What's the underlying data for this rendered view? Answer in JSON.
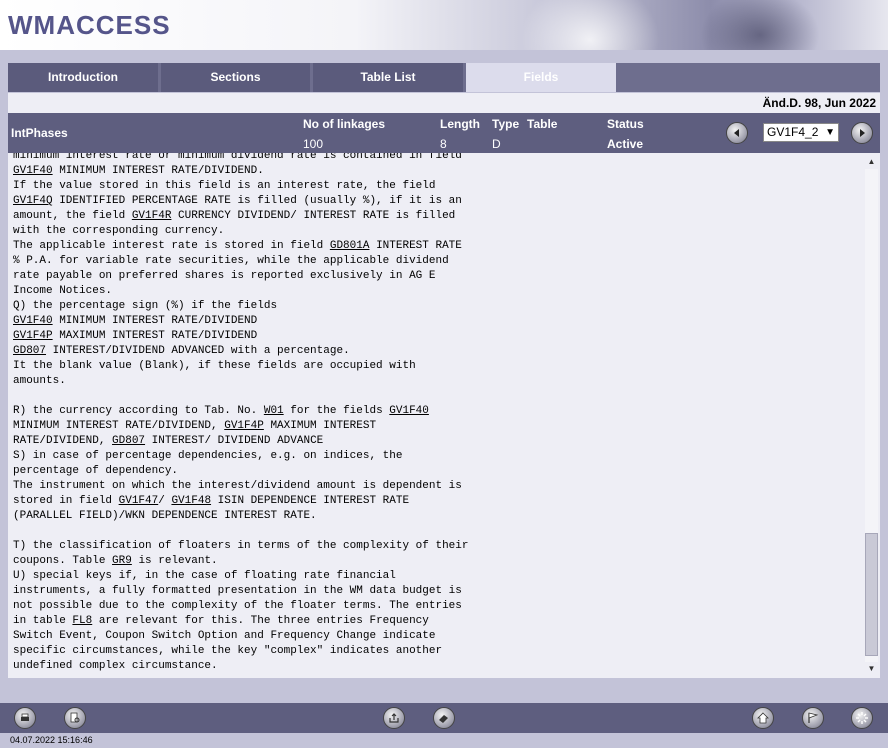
{
  "app": {
    "title": "WMACCESS"
  },
  "tabs": [
    {
      "label": "Introduction"
    },
    {
      "label": "Sections"
    },
    {
      "label": "Table List"
    },
    {
      "label": "Fields"
    }
  ],
  "date_info": "Änd.D. 98,  Jun 2022",
  "infobar": {
    "section": "IntPhases",
    "linkages_label": "No of linkages",
    "linkages_value": "100",
    "length_label": "Length",
    "length_value": "8",
    "type_label": "Type",
    "type_value": "D",
    "table_label": "Table",
    "status_label": "Status",
    "status_value": "Active",
    "field_select": "GV1F4_2"
  },
  "content_lines": [
    "minimum interest rate or minimum dividend rate is contained in field",
    "GV1F40 MINIMUM INTEREST RATE/DIVIDEND.",
    "If the value stored in this field is an interest rate, the field",
    "GV1F4Q IDENTIFIED PERCENTAGE RATE is filled (usually %), if it is an",
    "amount, the field GV1F4R CURRENCY DIVIDEND/ INTEREST RATE is filled",
    "with the corresponding currency.",
    "The applicable interest rate is stored in field GD801A INTEREST RATE",
    "% P.A. for variable rate securities, while the applicable dividend",
    "rate payable on preferred shares is reported exclusively in AG E",
    "Income Notices.",
    "Q) the percentage sign (%) if the fields",
    "GV1F40 MINIMUM INTEREST RATE/DIVIDEND",
    "GV1F4P MAXIMUM INTEREST RATE/DIVIDEND",
    "GD807 INTEREST/DIVIDEND ADVANCED with a percentage.",
    "It the blank value (Blank), if these fields are occupied with",
    "amounts.",
    "",
    "R) the currency according to Tab. No. W01 for the fields GV1F40",
    "MINIMUM INTEREST RATE/DIVIDEND, GV1F4P MAXIMUM INTEREST",
    "RATE/DIVIDEND, GD807 INTEREST/ DIVIDEND ADVANCE",
    "S) in case of percentage dependencies, e.g. on indices, the",
    "percentage of dependency.",
    "The instrument on which the interest/dividend amount is dependent is",
    "stored in field GV1F47/ GV1F48 ISIN DEPENDENCE INTEREST RATE",
    "(PARALLEL FIELD)/WKN DEPENDENCE INTEREST RATE.",
    "",
    "T) the classification of floaters in terms of the complexity of their",
    "coupons. Table GR9 is relevant.",
    "U) special keys if, in the case of floating rate financial",
    "instruments, a fully formatted presentation in the WM data budget is",
    "not possible due to the complexity of the floater terms. The entries",
    "in table FL8 are relevant for this. The three entries Frequency",
    "Switch Event, Coupon Switch Option and Frequency Change indicate",
    "specific circumstances, while the key \"complex\" indicates another",
    "undefined complex circumstance."
  ],
  "links": [
    "GV1F40",
    "GV1F4Q",
    "GV1F4R",
    "GD801A",
    "GV1F4P",
    "GD807",
    "W01",
    "GV1F47",
    "GV1F48",
    "GR9",
    "FL8"
  ],
  "footer": {
    "timestamp": "04.07.2022 15:16:46",
    "icons": [
      "print-icon",
      "search-document-icon",
      "export-icon",
      "eraser-icon",
      "home-icon",
      "flag-icon",
      "settings-icon"
    ]
  },
  "colors": {
    "bar": "#5e5e7f",
    "tab": "#5b5b7c",
    "tab_active": "#dcdcec",
    "content_bg": "#eeeef5",
    "logo": "#55558a"
  }
}
